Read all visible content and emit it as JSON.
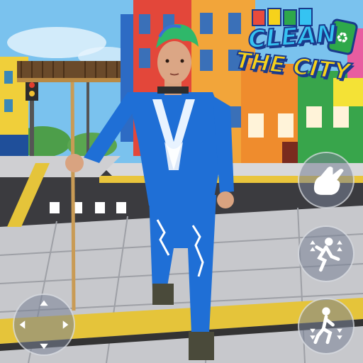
{
  "game": {
    "title_line1": "CLEAN",
    "title_line2": "THE CITY"
  },
  "controls": {
    "joystick": {
      "label": "movement-joystick"
    },
    "buttons": [
      {
        "name": "pickup-button",
        "icon": "hand-grab-icon"
      },
      {
        "name": "jump-button",
        "icon": "jump-icon"
      },
      {
        "name": "crouch-button",
        "icon": "crouch-icon"
      }
    ]
  },
  "colors": {
    "sky": "#7ac2ee",
    "character_outfit": "#1f6fd6",
    "hair": "#2fb86a",
    "logo_fill": "#35c3f2",
    "logo_outline": "#1a3a8c",
    "logo_accent": "#f6d21b"
  }
}
